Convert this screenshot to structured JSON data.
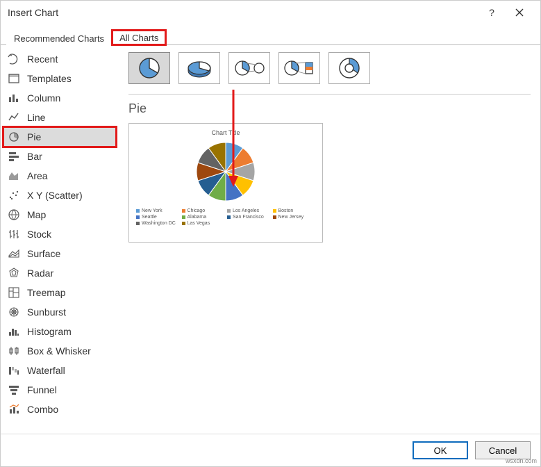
{
  "titlebar": {
    "title": "Insert Chart"
  },
  "tabs": {
    "recommended": "Recommended Charts",
    "all": "All Charts"
  },
  "sidebar": [
    "Recent",
    "Templates",
    "Column",
    "Line",
    "Pie",
    "Bar",
    "Area",
    "X Y (Scatter)",
    "Map",
    "Stock",
    "Surface",
    "Radar",
    "Treemap",
    "Sunburst",
    "Histogram",
    "Box & Whisker",
    "Waterfall",
    "Funnel",
    "Combo"
  ],
  "main": {
    "heading": "Pie",
    "preview_title": "Chart Title"
  },
  "legend": [
    {
      "label": "New York",
      "color": "#5b9bd5"
    },
    {
      "label": "Chicago",
      "color": "#ed7d31"
    },
    {
      "label": "Los Angeles",
      "color": "#a5a5a5"
    },
    {
      "label": "Boston",
      "color": "#ffc000"
    },
    {
      "label": "Seattle",
      "color": "#4472c4"
    },
    {
      "label": "Alabama",
      "color": "#70ad47"
    },
    {
      "label": "San Francisco",
      "color": "#255e91"
    },
    {
      "label": "New Jersey",
      "color": "#9e480e"
    },
    {
      "label": "Washington DC",
      "color": "#636363"
    },
    {
      "label": "Las Vegas",
      "color": "#997300"
    }
  ],
  "chart_data": {
    "type": "pie",
    "title": "Chart Title",
    "categories": [
      "New York",
      "Chicago",
      "Los Angeles",
      "Boston",
      "Seattle",
      "Alabama",
      "San Francisco",
      "New Jersey",
      "Washington DC",
      "Las Vegas"
    ],
    "values": [
      10,
      10,
      10,
      10,
      10,
      10,
      10,
      10,
      10,
      10
    ]
  },
  "footer": {
    "ok": "OK",
    "cancel": "Cancel"
  },
  "watermark": "wsxdn.com"
}
